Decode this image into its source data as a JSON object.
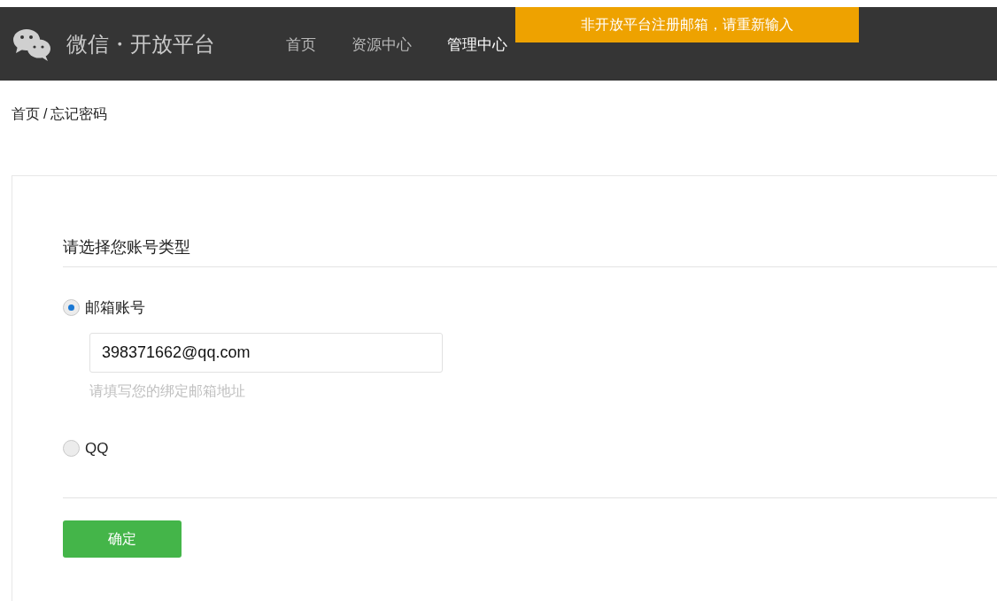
{
  "header": {
    "title": "微信・开放平台",
    "nav": [
      {
        "label": "首页",
        "selected": false
      },
      {
        "label": "资源中心",
        "selected": false
      },
      {
        "label": "管理中心",
        "selected": true
      }
    ]
  },
  "toast": {
    "message": "非开放平台注册邮箱，请重新输入"
  },
  "breadcrumb": {
    "items": [
      "首页",
      "忘记密码"
    ],
    "separator": "/"
  },
  "form": {
    "heading": "请选择您账号类型",
    "options": [
      {
        "label": "邮箱账号",
        "selected": true,
        "value": "398371662@qq.com",
        "hint": "请填写您的绑定邮箱地址"
      },
      {
        "label": "QQ",
        "selected": false
      }
    ],
    "submit": "确定"
  }
}
